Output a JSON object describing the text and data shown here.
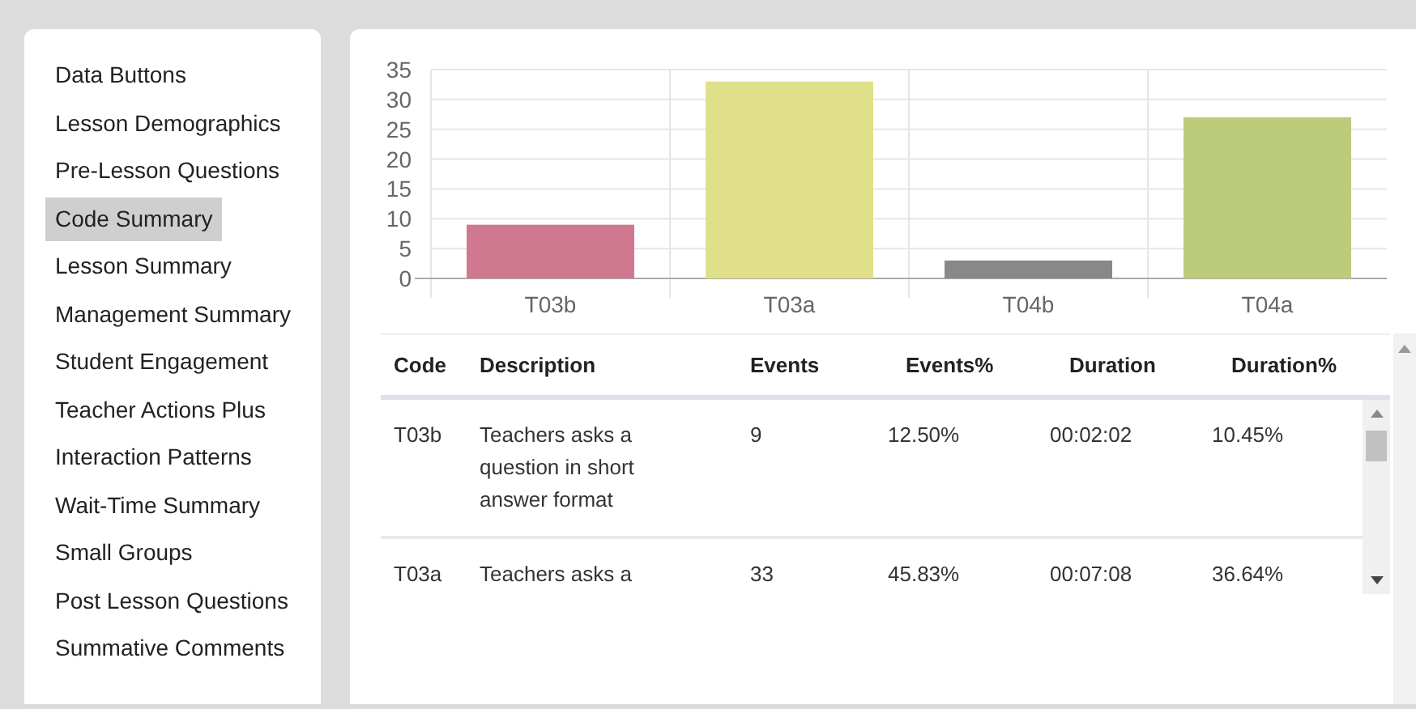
{
  "sidebar": {
    "items": [
      {
        "label": "Data Buttons",
        "selected": false
      },
      {
        "label": "Lesson Demographics",
        "selected": false
      },
      {
        "label": "Pre-Lesson Questions",
        "selected": false
      },
      {
        "label": "Code Summary",
        "selected": true
      },
      {
        "label": "Lesson Summary",
        "selected": false
      },
      {
        "label": "Management Summary",
        "selected": false
      },
      {
        "label": "Student Engagement",
        "selected": false
      },
      {
        "label": "Teacher Actions Plus",
        "selected": false
      },
      {
        "label": "Interaction Patterns",
        "selected": false
      },
      {
        "label": "Wait-Time Summary",
        "selected": false
      },
      {
        "label": "Small Groups",
        "selected": false
      },
      {
        "label": "Post Lesson Questions",
        "selected": false
      },
      {
        "label": "Summative Comments",
        "selected": false
      }
    ]
  },
  "chart": {
    "chart_data": {
      "type": "bar",
      "categories": [
        "T03b",
        "T03a",
        "T04b",
        "T04a"
      ],
      "values": [
        9,
        33,
        3,
        27
      ],
      "grid": true,
      "colors": [
        "#d07890",
        "#e1e08a",
        "#888888",
        "#bccc7a"
      ],
      "ylim": [
        0,
        35
      ],
      "yticks": [
        0,
        5,
        10,
        15,
        20,
        25,
        30,
        35
      ]
    }
  },
  "table": {
    "columns": [
      "Code",
      "Description",
      "Events",
      "Events%",
      "Duration",
      "Duration%"
    ],
    "rows": [
      [
        "T03b",
        "Teachers asks a question in short answer format",
        "9",
        "12.50%",
        "00:02:02",
        "10.45%"
      ],
      [
        "T03a",
        "Teachers asks a",
        "33",
        "45.83%",
        "00:07:08",
        "36.64%"
      ]
    ]
  }
}
